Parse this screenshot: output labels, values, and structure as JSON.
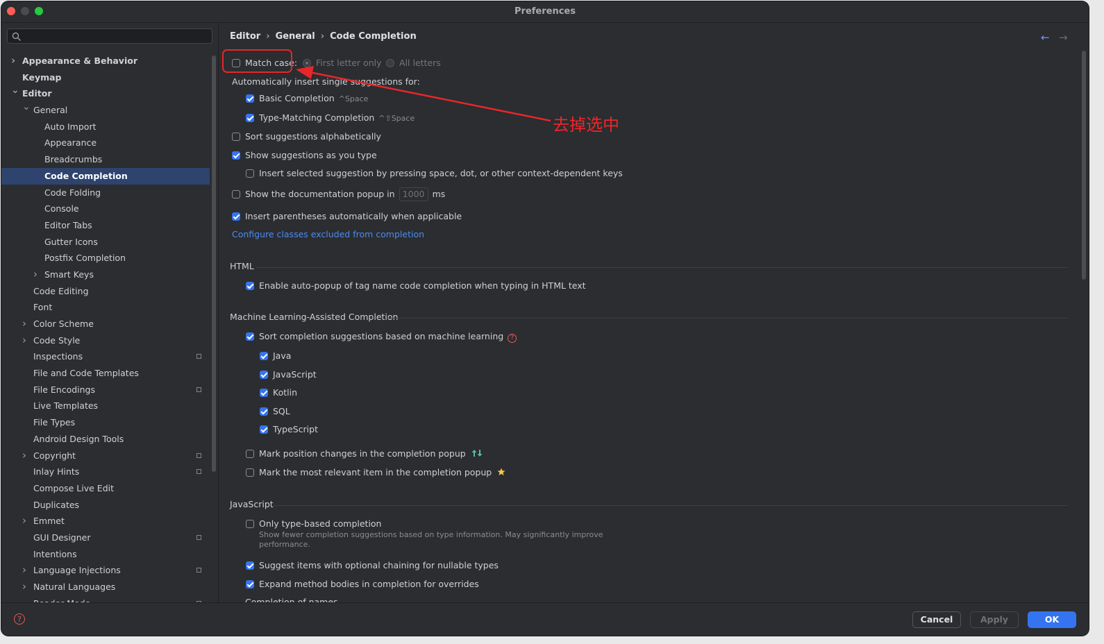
{
  "window": {
    "title": "Preferences"
  },
  "search": {
    "placeholder": ""
  },
  "sidebar": {
    "items": [
      {
        "label": "Appearance & Behavior",
        "level": 0,
        "chevron": "right",
        "bold": true
      },
      {
        "label": "Keymap",
        "level": 0,
        "chevron": "",
        "bold": true
      },
      {
        "label": "Editor",
        "level": 0,
        "chevron": "down",
        "bold": true
      },
      {
        "label": "General",
        "level": 1,
        "chevron": "down"
      },
      {
        "label": "Auto Import",
        "level": 2,
        "chevron": ""
      },
      {
        "label": "Appearance",
        "level": 2,
        "chevron": ""
      },
      {
        "label": "Breadcrumbs",
        "level": 2,
        "chevron": ""
      },
      {
        "label": "Code Completion",
        "level": 2,
        "chevron": "",
        "selected": true
      },
      {
        "label": "Code Folding",
        "level": 2,
        "chevron": ""
      },
      {
        "label": "Console",
        "level": 2,
        "chevron": ""
      },
      {
        "label": "Editor Tabs",
        "level": 2,
        "chevron": ""
      },
      {
        "label": "Gutter Icons",
        "level": 2,
        "chevron": ""
      },
      {
        "label": "Postfix Completion",
        "level": 2,
        "chevron": ""
      },
      {
        "label": "Smart Keys",
        "level": 2,
        "chevron": "right"
      },
      {
        "label": "Code Editing",
        "level": 1,
        "chevron": ""
      },
      {
        "label": "Font",
        "level": 1,
        "chevron": ""
      },
      {
        "label": "Color Scheme",
        "level": 1,
        "chevron": "right"
      },
      {
        "label": "Code Style",
        "level": 1,
        "chevron": "right"
      },
      {
        "label": "Inspections",
        "level": 1,
        "chevron": "",
        "badge": true
      },
      {
        "label": "File and Code Templates",
        "level": 1,
        "chevron": ""
      },
      {
        "label": "File Encodings",
        "level": 1,
        "chevron": "",
        "badge": true
      },
      {
        "label": "Live Templates",
        "level": 1,
        "chevron": ""
      },
      {
        "label": "File Types",
        "level": 1,
        "chevron": ""
      },
      {
        "label": "Android Design Tools",
        "level": 1,
        "chevron": ""
      },
      {
        "label": "Copyright",
        "level": 1,
        "chevron": "right",
        "badge": true
      },
      {
        "label": "Inlay Hints",
        "level": 1,
        "chevron": "",
        "badge": true
      },
      {
        "label": "Compose Live Edit",
        "level": 1,
        "chevron": ""
      },
      {
        "label": "Duplicates",
        "level": 1,
        "chevron": ""
      },
      {
        "label": "Emmet",
        "level": 1,
        "chevron": "right"
      },
      {
        "label": "GUI Designer",
        "level": 1,
        "chevron": "",
        "badge": true
      },
      {
        "label": "Intentions",
        "level": 1,
        "chevron": ""
      },
      {
        "label": "Language Injections",
        "level": 1,
        "chevron": "right",
        "badge": true
      },
      {
        "label": "Natural Languages",
        "level": 1,
        "chevron": "right"
      },
      {
        "label": "Reader Mode",
        "level": 1,
        "chevron": "",
        "badge": true
      }
    ]
  },
  "breadcrumb": {
    "part1": "Editor",
    "part2": "General",
    "part3": "Code Completion",
    "sep": "›"
  },
  "content": {
    "match_case": "Match case:",
    "first_letter_only": "First letter only",
    "all_letters": "All letters",
    "auto_insert_heading": "Automatically insert single suggestions for:",
    "basic_completion": "Basic Completion",
    "basic_shortcut": "^Space",
    "type_matching": "Type-Matching Completion",
    "type_matching_shortcut": "^⇧Space",
    "sort_alpha": "Sort suggestions alphabetically",
    "show_as_type": "Show suggestions as you type",
    "insert_selected": "Insert selected suggestion by pressing space, dot, or other context-dependent keys",
    "doc_popup_pre": "Show the documentation popup in",
    "doc_popup_value": "1000",
    "doc_popup_unit": "ms",
    "insert_parens": "Insert parentheses automatically when applicable",
    "configure_link": "Configure classes excluded from completion",
    "html_section": "HTML",
    "html_autopopup": "Enable auto-popup of tag name code completion when typing in HTML text",
    "ml_section": "Machine Learning-Assisted Completion",
    "ml_sort": "Sort completion suggestions based on machine learning",
    "ml_java": "Java",
    "ml_javascript": "JavaScript",
    "ml_kotlin": "Kotlin",
    "ml_sql": "SQL",
    "ml_typescript": "TypeScript",
    "mark_position": "Mark position changes in the completion popup",
    "mark_relevant": "Mark the most relevant item in the completion popup",
    "js_section": "JavaScript",
    "only_type_based": "Only type-based completion",
    "only_type_hint_1": "Show fewer completion suggestions based on type information. May significantly improve",
    "only_type_hint_2": "performance.",
    "optional_chaining": "Suggest items with optional chaining for nullable types",
    "expand_method": "Expand method bodies in completion for overrides",
    "completion_of_names": "Completion of names"
  },
  "buttons": {
    "cancel": "Cancel",
    "apply": "Apply",
    "ok": "OK"
  },
  "annotation": {
    "text": "去掉选中",
    "color": "#e8262a"
  },
  "colors": {
    "accent": "#3574f0",
    "selection": "#2e436e",
    "link": "#4a8bf5"
  }
}
